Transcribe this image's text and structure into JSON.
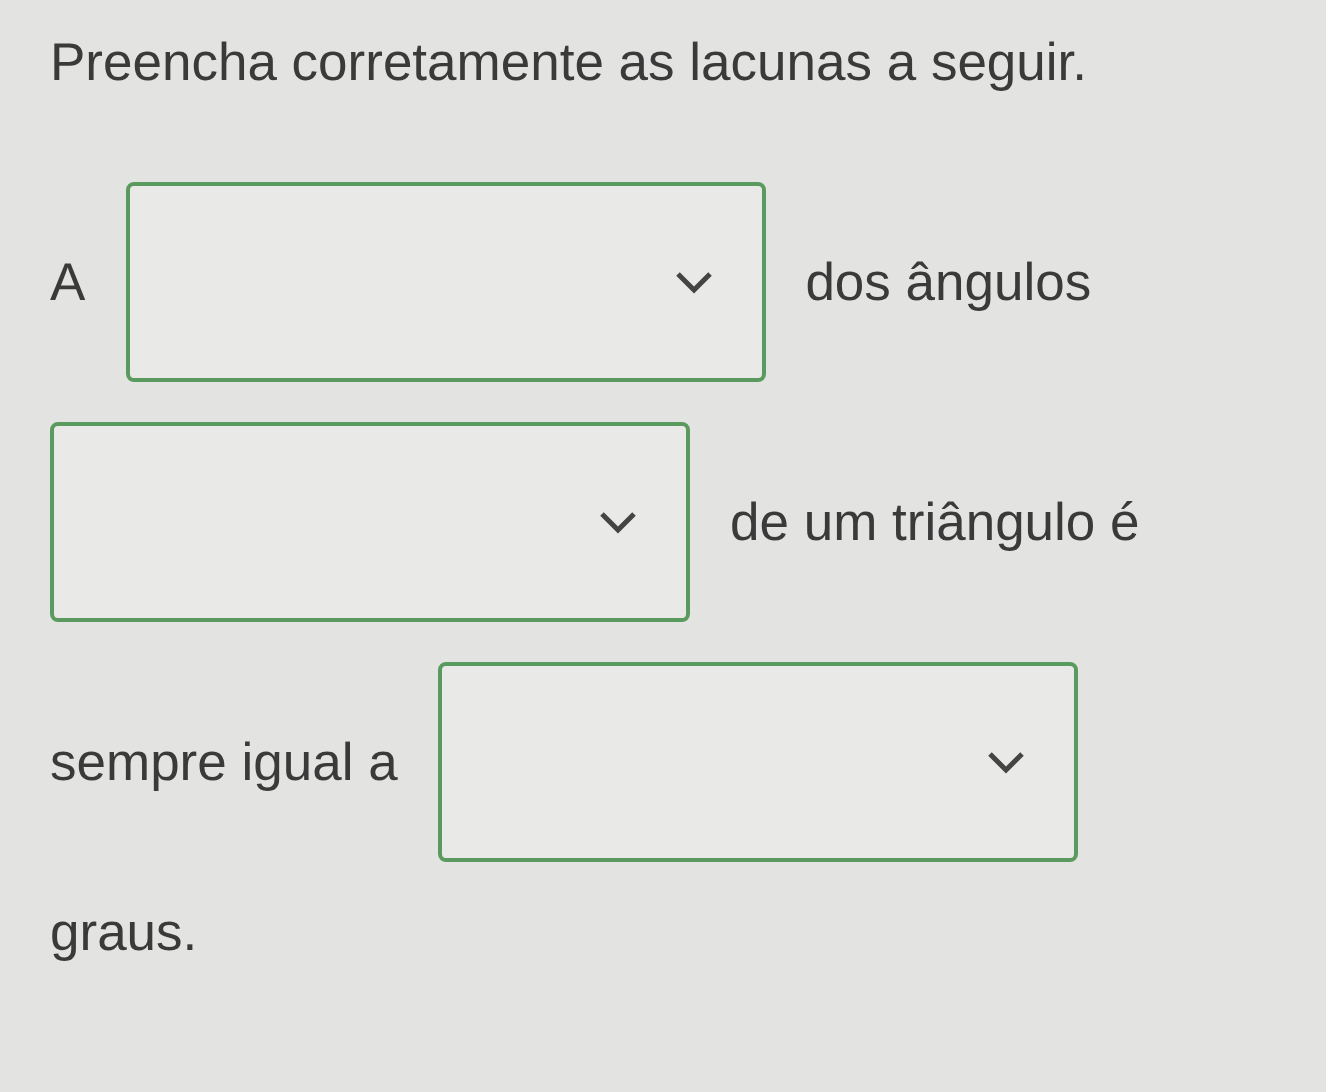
{
  "instruction": "Preencha corretamente as lacunas a seguir.",
  "lines": [
    [
      {
        "kind": "text",
        "text": "A"
      },
      {
        "kind": "dropdown"
      },
      {
        "kind": "text",
        "text": "dos ângulos"
      }
    ],
    [
      {
        "kind": "dropdown"
      },
      {
        "kind": "text",
        "text": "de um triângulo é"
      }
    ],
    [
      {
        "kind": "text",
        "text": "sempre igual a"
      },
      {
        "kind": "dropdown"
      }
    ],
    [
      {
        "kind": "text",
        "text": "graus."
      }
    ]
  ]
}
